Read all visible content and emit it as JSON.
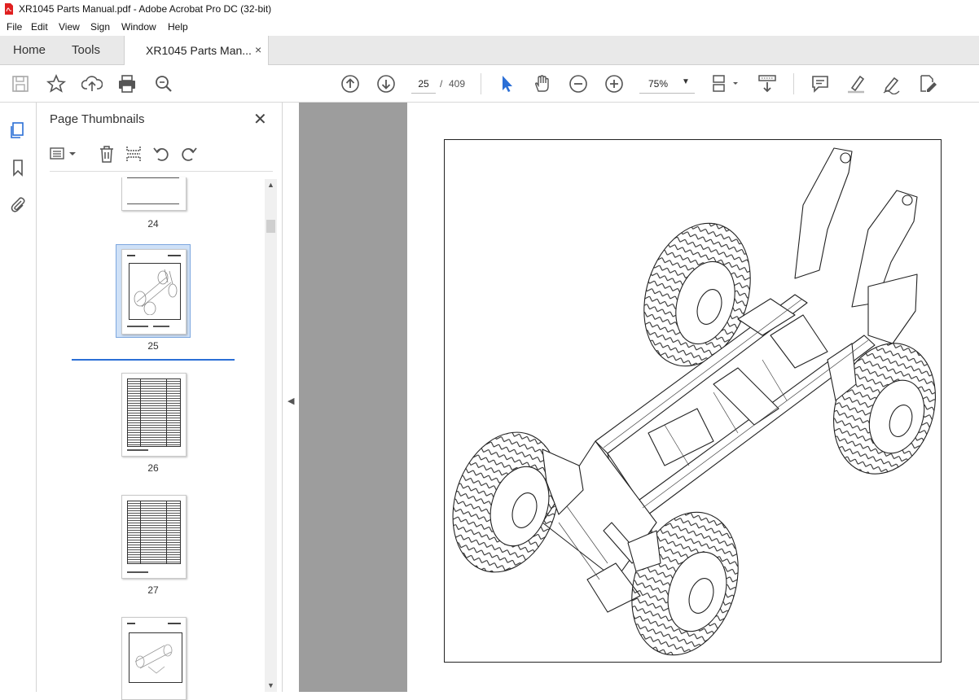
{
  "window": {
    "title": "XR1045 Parts Manual.pdf - Adobe Acrobat Pro DC (32-bit)"
  },
  "menu": [
    "File",
    "Edit",
    "View",
    "Sign",
    "Window",
    "Help"
  ],
  "tabs": {
    "home": "Home",
    "tools": "Tools",
    "document": "XR1045 Parts Man...",
    "close": "×"
  },
  "toolbar": {
    "page_current": "25",
    "page_separator": "/",
    "page_total": "409",
    "zoom": "75%",
    "icons": [
      "save-icon",
      "star-icon",
      "upload-icon",
      "print-icon",
      "search-zoom-icon",
      "page-up-icon",
      "page-down-icon",
      "select-arrow-icon",
      "hand-icon",
      "zoom-out-icon",
      "zoom-in-icon",
      "fit-page-icon",
      "scroll-mode-icon",
      "comment-icon",
      "highlight-icon",
      "sign-icon",
      "fill-sign-icon"
    ]
  },
  "sidebar": {
    "title": "Page Thumbnails",
    "close": "✕",
    "thumbnails": [
      {
        "label": "24"
      },
      {
        "label": "25",
        "selected": true
      },
      {
        "label": "26"
      },
      {
        "label": "27"
      },
      {
        "label": ""
      }
    ]
  },
  "colors": {
    "accent": "#2b6fd6",
    "gray_bg": "#9d9d9d",
    "selection": "#cfe1f7"
  }
}
